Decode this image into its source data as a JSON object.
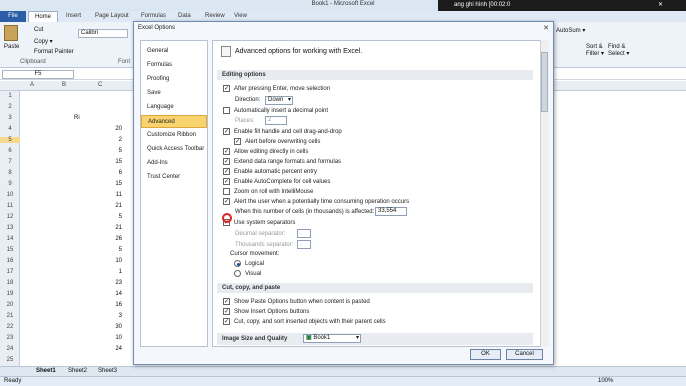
{
  "window": {
    "title": "Book1 - Microsoft Excel",
    "recorder": "ang ghi hình [00:02:0"
  },
  "tabs": {
    "file": "File",
    "home": "Home",
    "insert": "Insert",
    "page_layout": "Page Layout",
    "formulas": "Formulas",
    "data": "Data",
    "review": "Review",
    "view": "View"
  },
  "ribbon": {
    "paste": "Paste",
    "cut": "Cut",
    "copy": "Copy ▾",
    "format_painter": "Format Painter",
    "clipboard": "Clipboard",
    "font_name": "Calibri",
    "font_group": "Font",
    "autosum": "AutoSum ▾",
    "sort_filter": "Sort & Filter ▾",
    "find_select": "Find & Select ▾"
  },
  "namebox": "F5",
  "columns": [
    "A",
    "B",
    "C"
  ],
  "rows": [
    "1",
    "2",
    "3",
    "4",
    "5",
    "6",
    "7",
    "8",
    "9",
    "10",
    "11",
    "12",
    "13",
    "14",
    "15",
    "16",
    "17",
    "18",
    "19",
    "20",
    "21",
    "22",
    "23",
    "24",
    "25"
  ],
  "cells": {
    "header": "Ri",
    "values": [
      "20",
      "2",
      "5",
      "15",
      "6",
      "15",
      "11",
      "21",
      "5",
      "21",
      "26",
      "5",
      "10",
      "1",
      "23",
      "14",
      "16",
      "3",
      "30",
      "10",
      "24"
    ]
  },
  "sheets": {
    "s1": "Sheet1",
    "s2": "Sheet2",
    "s3": "Sheet3"
  },
  "status": {
    "ready": "Ready",
    "zoom": "100%"
  },
  "dialog": {
    "title": "Excel Options",
    "close": "✕",
    "nav": [
      "General",
      "Formulas",
      "Proofing",
      "Save",
      "Language",
      "Advanced",
      "Customize Ribbon",
      "Quick Access Toolbar",
      "Add-Ins",
      "Trust Center"
    ],
    "header": "Advanced options for working with Excel.",
    "sections": {
      "editing": "Editing options",
      "cut_copy": "Cut, copy, and paste",
      "image": "Image Size and Quality"
    },
    "options": {
      "after_enter": "After pressing Enter, move selection",
      "direction_label": "Direction:",
      "direction_value": "Down",
      "auto_decimal": "Automatically insert a decimal point",
      "places_label": "Places:",
      "places_value": "2",
      "fill_handle": "Enable fill handle and cell drag-and-drop",
      "alert_overwrite": "Alert before overwriting cells",
      "edit_in_cells": "Allow editing directly in cells",
      "extend_ranges": "Extend data range formats and formulas",
      "auto_percent": "Enable automatic percent entry",
      "autocomplete": "Enable AutoComplete for cell values",
      "zoom_roll": "Zoom on roll with IntelliMouse",
      "alert_slow": "Alert the user when a potentially time consuming operation occurs",
      "cells_affected_label": "When this number of cells (in thousands) is affected:",
      "cells_affected_value": "33,554",
      "system_separators": "Use system separators",
      "decimal_sep": "Decimal separator:",
      "decimal_sep_value": ".",
      "thousands_sep": "Thousands separator:",
      "thousands_sep_value": ",",
      "cursor_movement": "Cursor movement:",
      "logical": "Logical",
      "visual": "Visual",
      "paste_options": "Show Paste Options button when content is pasted",
      "insert_options": "Show Insert Options buttons",
      "cut_copy_sort": "Cut, copy, and sort inserted objects with their parent cells",
      "image_book": "Book1"
    },
    "ok": "OK",
    "cancel": "Cancel"
  }
}
